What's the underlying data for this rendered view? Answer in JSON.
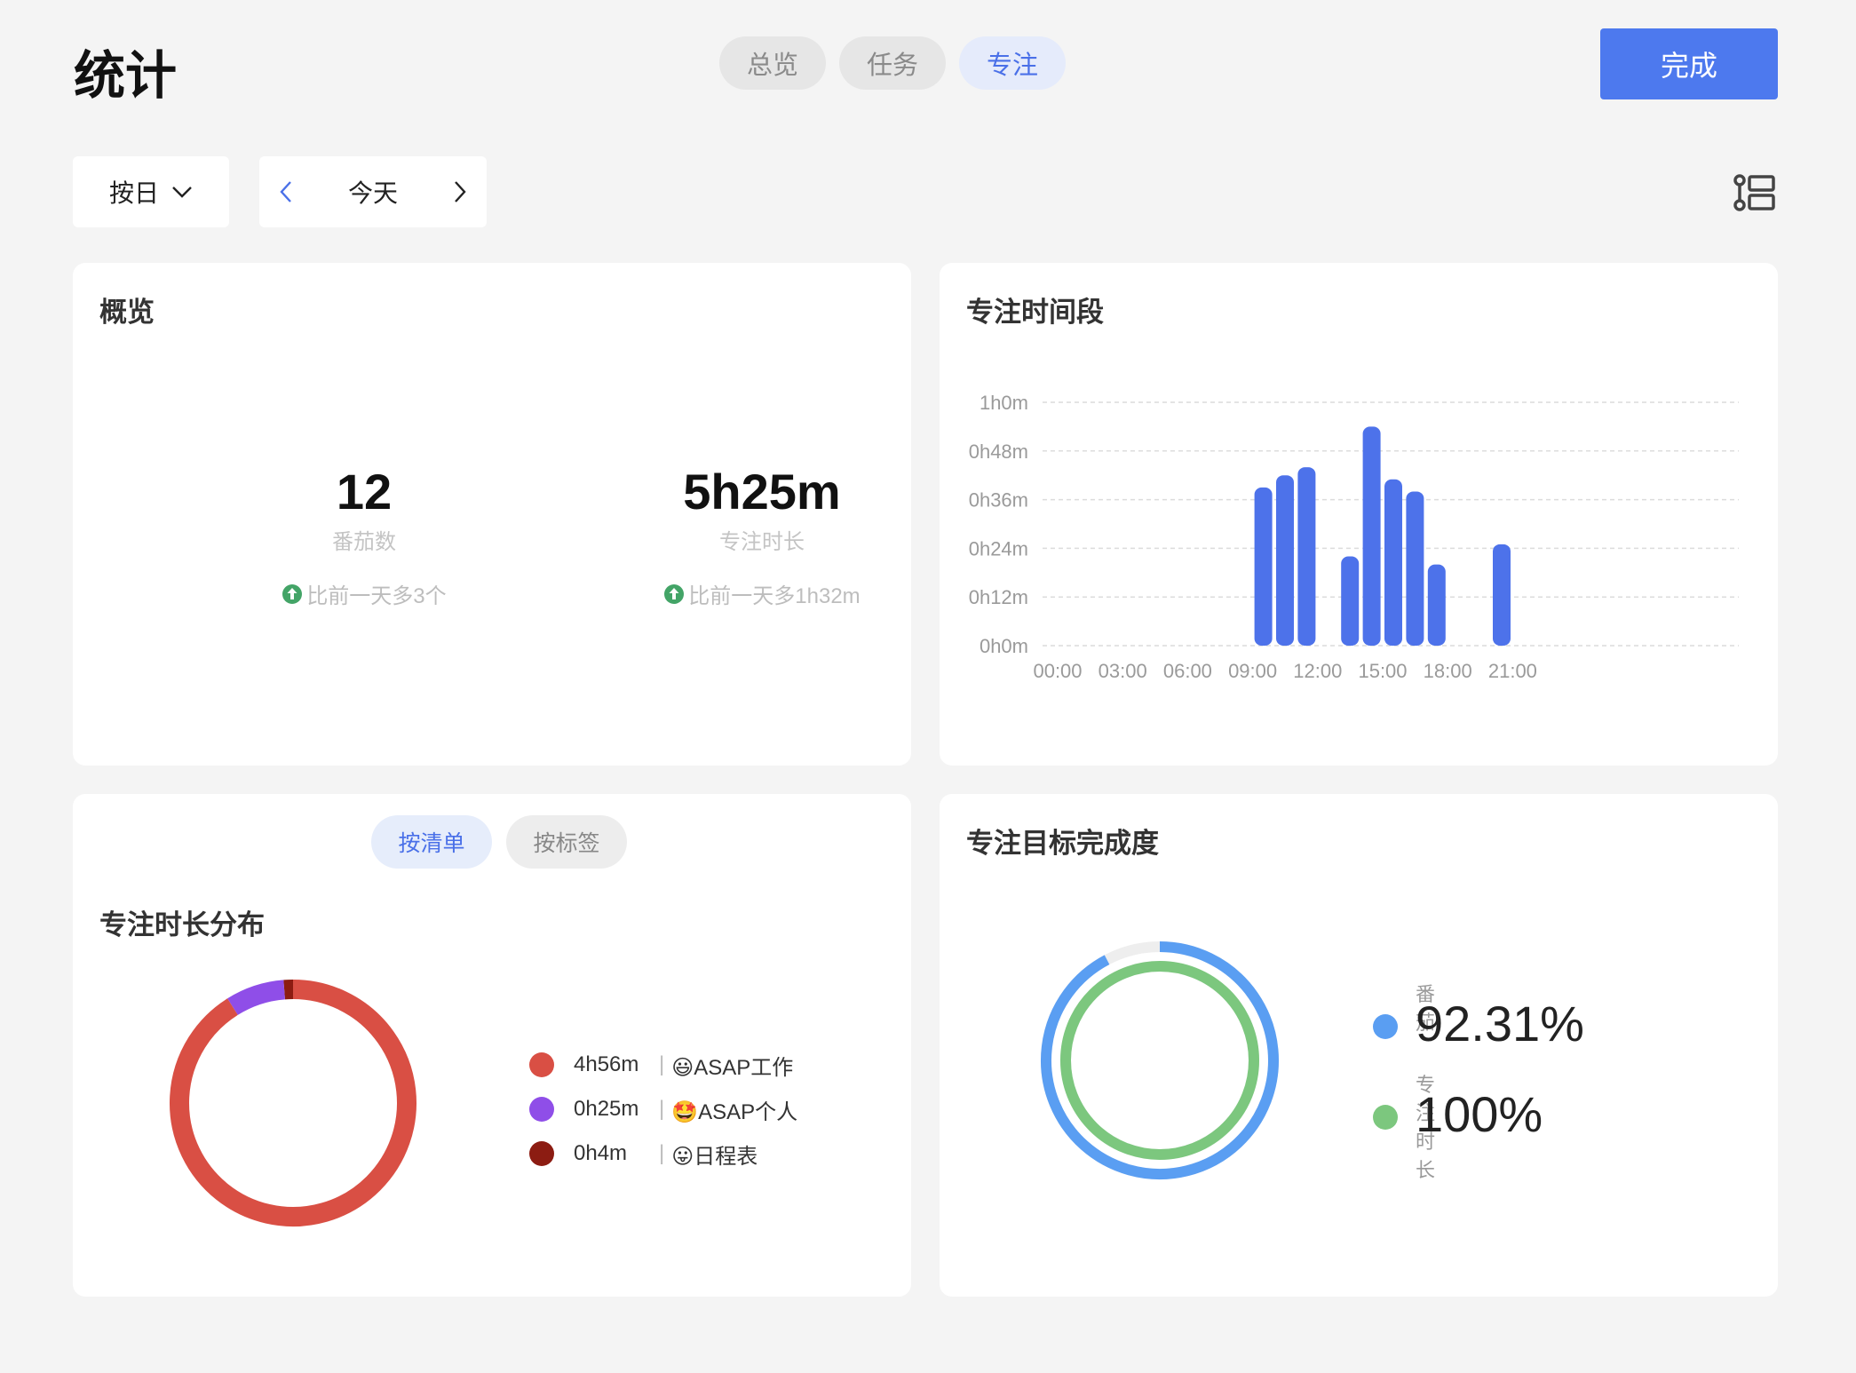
{
  "header": {
    "title": "统计",
    "tabs": [
      {
        "label": "总览",
        "active": false
      },
      {
        "label": "任务",
        "active": false
      },
      {
        "label": "专注",
        "active": true
      }
    ],
    "done_label": "完成"
  },
  "toolbar": {
    "period": "按日",
    "date_label": "今天",
    "prev_icon": "chevron-left-icon",
    "next_icon": "chevron-right-icon",
    "list_icon": "list-settings-icon"
  },
  "overview": {
    "title": "概览",
    "pomodoro": {
      "value": "12",
      "label": "番茄数",
      "compare": "比前一天多3个"
    },
    "focus": {
      "value": "5h25m",
      "label": "专注时长",
      "compare": "比前一天多1h32m"
    },
    "up_color": "#43a467"
  },
  "timeline": {
    "title": "专注时间段",
    "bar_color": "#4d72ea",
    "chart_data": {
      "type": "bar",
      "xlabel": "",
      "ylabel": "",
      "y_unit": "minutes",
      "ylim": [
        0,
        60
      ],
      "yticks": [
        "1h0m",
        "0h48m",
        "0h36m",
        "0h24m",
        "0h12m",
        "0h0m"
      ],
      "xticks": [
        "00:00",
        "03:00",
        "06:00",
        "09:00",
        "12:00",
        "15:00",
        "18:00",
        "21:00"
      ],
      "x_unit": "hour",
      "bars": [
        {
          "hour": 9.0,
          "value": 39
        },
        {
          "hour": 10.0,
          "value": 42
        },
        {
          "hour": 11.0,
          "value": 44
        },
        {
          "hour": 13.0,
          "value": 22
        },
        {
          "hour": 14.0,
          "value": 54
        },
        {
          "hour": 15.0,
          "value": 41
        },
        {
          "hour": 16.0,
          "value": 38
        },
        {
          "hour": 17.0,
          "value": 20
        },
        {
          "hour": 20.0,
          "value": 25
        }
      ]
    }
  },
  "distribution": {
    "tabs": [
      {
        "label": "按清单",
        "active": true
      },
      {
        "label": "按标签",
        "active": false
      }
    ],
    "title": "专注时长分布",
    "chart_data": {
      "type": "pie",
      "donut": true,
      "slices": [
        {
          "time": "4h56m",
          "name": "😃ASAP工作",
          "minutes": 296,
          "color": "#d94f44"
        },
        {
          "time": "0h25m",
          "name": "🤩ASAP个人",
          "minutes": 25,
          "color": "#8f4ee8"
        },
        {
          "time": "0h4m",
          "name": "😛日程表",
          "minutes": 4,
          "color": "#8c1c12"
        }
      ]
    }
  },
  "goals": {
    "title": "专注目标完成度",
    "chart_data": {
      "type": "pie",
      "donut": true,
      "rings": [
        {
          "name": "番茄",
          "display": "92.31%",
          "percent": 92.31,
          "color": "#5a9ef2"
        },
        {
          "name": "专注时长",
          "display": "100%",
          "percent": 100,
          "color": "#7cc77e"
        }
      ],
      "track_color": "#eeeeee"
    }
  }
}
